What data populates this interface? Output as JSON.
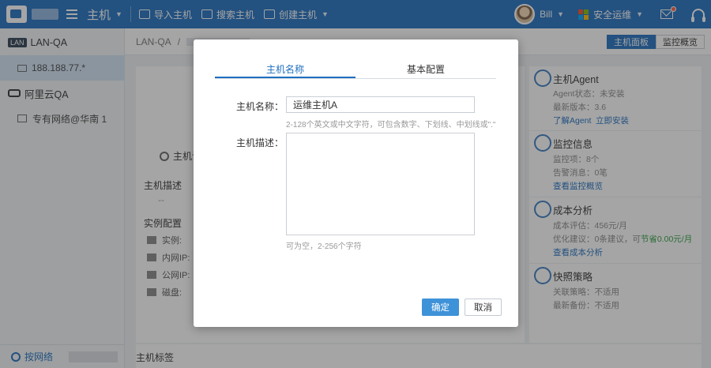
{
  "topbar": {
    "title": "主机",
    "actions": [
      {
        "label": "导入主机",
        "icon": "import-icon"
      },
      {
        "label": "搜索主机",
        "icon": "search-host-icon"
      },
      {
        "label": "创建主机",
        "icon": "create-host-icon"
      }
    ],
    "user_name": "Bill",
    "org_name": "安全运维",
    "colors": {
      "bar": "#1f6fbf",
      "notify_dot": "#ff5a3c"
    }
  },
  "sidebar": {
    "lan_badge": "LAN",
    "lan_group": "LAN-QA",
    "active_host": "188.188.77.*",
    "cloud_group": "阿里云QA",
    "network_item": "专有网络@华南 1",
    "bottom_tab": "按网络"
  },
  "main": {
    "breadcrumb_root": "LAN-QA",
    "view_toggle": {
      "active": "主机面板",
      "other": "监控概览"
    },
    "gear_label": "主机设",
    "desc_label": "主机描述",
    "desc_value": "--",
    "instance_label": "实例配置",
    "specs": [
      {
        "label": "实例:"
      },
      {
        "label": "内网IP:"
      },
      {
        "label": "公网IP:"
      },
      {
        "label": "磁盘:"
      }
    ],
    "bottom_label": "主机标签"
  },
  "right_panel": {
    "agent": {
      "title": "主机Agent",
      "status": "Agent状态：未安装",
      "version": "最新版本：3.6",
      "link1": "了解Agent",
      "link2": "立即安装"
    },
    "monitor": {
      "title": "监控信息",
      "items": "监控项：8个",
      "alerts": "告警消息：0笔",
      "link": "查看监控概览"
    },
    "cost": {
      "title": "成本分析",
      "estimate": "成本评估：456元/月",
      "advice_prefix": "优化建议：0条建议，可",
      "advice_saving": "节省0.00元/月",
      "link": "查看成本分析"
    },
    "snapshot": {
      "title": "快照策略",
      "policy": "关联策略：不适用",
      "backup": "最新备份：不适用"
    }
  },
  "modal": {
    "tabs": [
      "主机名称",
      "基本配置"
    ],
    "active_tab": 0,
    "name_label": "主机名称：",
    "name_value": "运维主机A",
    "name_hint": "2-128个英文或中文字符，可包含数字、下划线、中划线或\".\"",
    "desc_label": "主机描述：",
    "desc_value": "",
    "desc_hint": "可为空，2-256个字符",
    "ok_label": "确定",
    "cancel_label": "取消",
    "colors": {
      "accent": "#1f6fbf",
      "ok_button": "#3e92d8"
    }
  }
}
